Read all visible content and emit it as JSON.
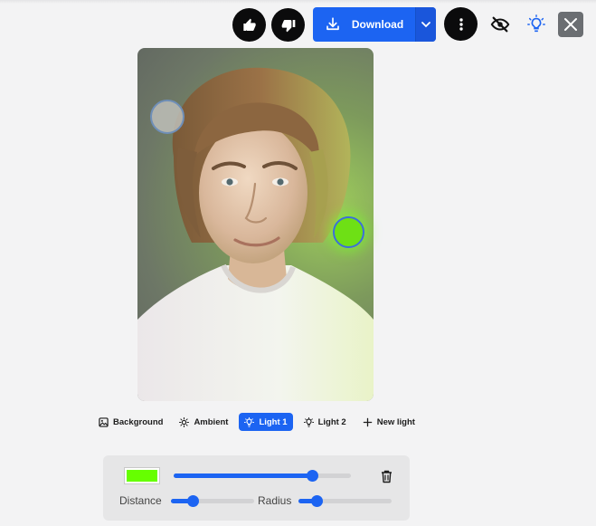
{
  "toolbar": {
    "thumbs_up_icon": "thumbs-up-icon",
    "thumbs_down_icon": "thumbs-down-icon",
    "download_label": "Download",
    "more_icon": "more-vertical-icon",
    "hide_icon": "eye-off-icon",
    "light_icon": "lightbulb-icon",
    "close_icon": "close-icon"
  },
  "colors": {
    "accent": "#1c64f2",
    "light1": "#66ff00"
  },
  "tabs": [
    {
      "label": "Background",
      "icon": "image-icon",
      "active": false
    },
    {
      "label": "Ambient",
      "icon": "sun-icon",
      "active": false
    },
    {
      "label": "Light 1",
      "icon": "lightbulb-icon",
      "active": true
    },
    {
      "label": "Light 2",
      "icon": "lightbulb-icon",
      "active": false
    },
    {
      "label": "New light",
      "icon": "plus-icon",
      "active": false
    }
  ],
  "controls": {
    "intensity_value": 0.78,
    "distance_label": "Distance",
    "distance_value": 0.26,
    "radius_label": "Radius",
    "radius_value": 0.19
  }
}
